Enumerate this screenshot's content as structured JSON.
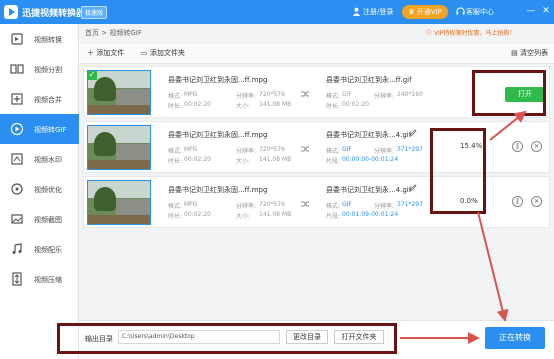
{
  "titlebar": {
    "app_title": "迅捷视频转换器",
    "edition": "极速版",
    "login": "注册/登录",
    "vip": "开通VIP",
    "service": "客服中心",
    "minimize": "—",
    "close": "✕"
  },
  "sidebar": {
    "items": [
      {
        "label": "视频转换",
        "icon": "video-convert-icon"
      },
      {
        "label": "视频分割",
        "icon": "video-split-icon"
      },
      {
        "label": "视频合并",
        "icon": "video-merge-icon"
      },
      {
        "label": "视频转GIF",
        "icon": "gif-icon",
        "active": true
      },
      {
        "label": "视频水印",
        "icon": "watermark-icon"
      },
      {
        "label": "视频优化",
        "icon": "optimize-icon"
      },
      {
        "label": "视频截图",
        "icon": "screenshot-icon"
      },
      {
        "label": "视频配乐",
        "icon": "music-icon"
      },
      {
        "label": "视频压缩",
        "icon": "compress-icon"
      }
    ]
  },
  "breadcrumb": {
    "home": "首页",
    "sep": ">",
    "current": "视频转GIF"
  },
  "notice": "VIP特权限时优惠，马上抢购！",
  "toolbar": {
    "add_file": "添加文件",
    "add_folder": "添加文件夹",
    "clear_list": "清空列表"
  },
  "labels": {
    "format": "格式:",
    "resolution": "分辨率:",
    "duration": "时长:",
    "size": "大小:",
    "clip": "片段:"
  },
  "files": [
    {
      "src_name": "县委书记刘卫红到永固...ff.mpg",
      "src_format": "MPG",
      "src_resolution": "720*576",
      "src_duration": "00:02:20",
      "src_size": "141.08 MB",
      "dst_name": "县委书记刘卫红到永...ff.gif",
      "dst_format": "GIF",
      "dst_resolution": "240*160",
      "dst_duration": "00:02:20",
      "status": "done",
      "action": "打开"
    },
    {
      "src_name": "县委书记刘卫红到永固...ff.mpg",
      "src_format": "MPG",
      "src_resolution": "720*576",
      "src_duration": "00:02:20",
      "src_size": "141.08 MB",
      "dst_name": "县委书记刘卫红到永...4.gif",
      "dst_format": "GIF",
      "dst_resolution": "371*297",
      "dst_clip": "00:00:00-00:01:24",
      "progress": "15.4%"
    },
    {
      "src_name": "县委书记刘卫红到永固...ff.mpg",
      "src_format": "MPG",
      "src_resolution": "720*576",
      "src_duration": "00:02:20",
      "src_size": "141.08 MB",
      "dst_name": "县委书记刘卫红到永...4.gif",
      "dst_format": "GIF",
      "dst_resolution": "371*297",
      "dst_clip": "00:01:09-00:01:24",
      "progress": "0.0%"
    }
  ],
  "bottom": {
    "output_label": "输出目录",
    "output_path": "C:\\Users\\admin\\Desktop",
    "change_dir": "更改目录",
    "open_folder": "打开文件夹",
    "convert": "正在转换"
  },
  "colors": {
    "accent": "#2a8ff0",
    "success": "#2fb84b",
    "vip": "#f4a322",
    "annotation": "#6b1212"
  }
}
